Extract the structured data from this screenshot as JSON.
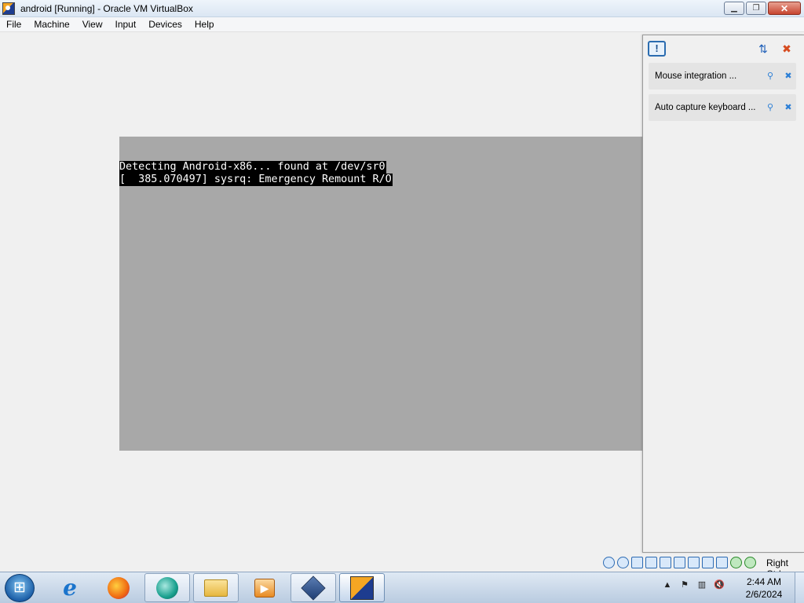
{
  "window": {
    "title": "android  [Running] - Oracle VM VirtualBox",
    "controls": {
      "minimize_icon": "minimize-icon",
      "restore_icon": "restore-icon",
      "close_icon": "close-icon"
    }
  },
  "menu": {
    "items": [
      "File",
      "Machine",
      "View",
      "Input",
      "Devices",
      "Help"
    ]
  },
  "vm_console": {
    "lines": [
      "Detecting Android-x86... found at /dev/sr0",
      "[  385.070497] sysrq: Emergency Remount R/O"
    ]
  },
  "notification_center": {
    "icons": [
      "notification-center-icon",
      "sort-icon",
      "dismiss-all-icon"
    ],
    "notifications": [
      {
        "text": "Mouse integration ...",
        "actions": [
          "pin-icon",
          "close-icon"
        ]
      },
      {
        "text": "Auto capture keyboard ...",
        "actions": [
          "pin-icon",
          "close-icon"
        ]
      }
    ]
  },
  "status_bar": {
    "icons": [
      "hard-disk-icon",
      "optical-drive-icon",
      "audio-icon",
      "network-icon",
      "usb-icon",
      "shared-folders-icon",
      "display-icon",
      "recording-icon",
      "cpu-icon",
      "mouse-integration-icon",
      "host-key-icon"
    ],
    "host_key": "Right Ctrl"
  },
  "taskbar": {
    "apps": [
      "start-orb",
      "internet-explorer-icon",
      "firefox-icon",
      "app-icon",
      "file-explorer-icon",
      "media-player-icon",
      "virtualbox-manager-icon",
      "virtualbox-vm-icon"
    ],
    "tray_icons": [
      "show-hidden-icons",
      "action-center-flag-icon",
      "network-icon",
      "volume-muted-icon"
    ],
    "clock": {
      "time": "2:44 AM",
      "date": "2/6/2024"
    }
  },
  "colors": {
    "vm_screen": "#a8a8a8",
    "console_bg": "#000000",
    "console_fg": "#ffffff",
    "taskbar": "#c9d8ea"
  }
}
